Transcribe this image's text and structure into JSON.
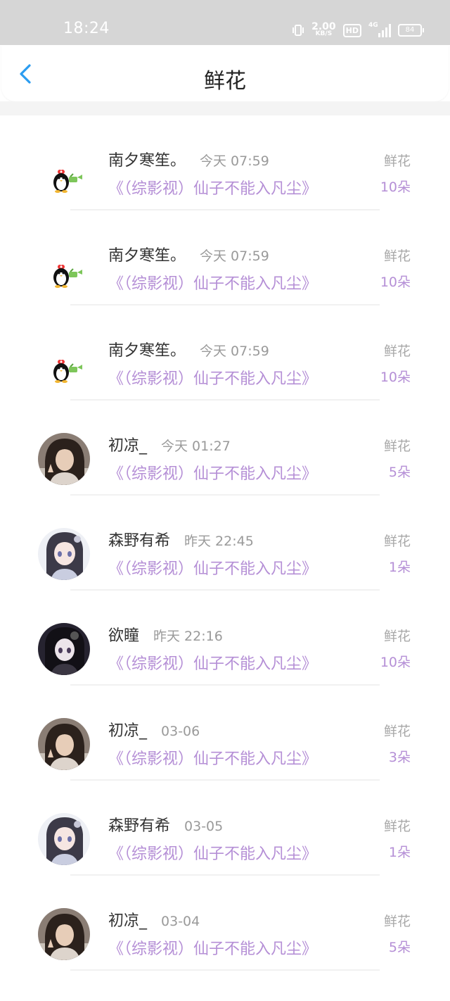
{
  "status": {
    "time": "18:24",
    "net_speed": "2.00",
    "net_unit": "KB/S",
    "hd": "HD",
    "signal": "4G",
    "battery": "84"
  },
  "header": {
    "title": "鲜花"
  },
  "records": [
    {
      "name": "南夕寒笙。",
      "time": "今天 07:59",
      "book": "《（综影视）仙子不能入凡尘》",
      "tag": "鲜花",
      "count": "10朵",
      "avatar": "penguin"
    },
    {
      "name": "南夕寒笙。",
      "time": "今天 07:59",
      "book": "《（综影视）仙子不能入凡尘》",
      "tag": "鲜花",
      "count": "10朵",
      "avatar": "penguin"
    },
    {
      "name": "南夕寒笙。",
      "time": "今天 07:59",
      "book": "《（综影视）仙子不能入凡尘》",
      "tag": "鲜花",
      "count": "10朵",
      "avatar": "penguin"
    },
    {
      "name": "初凉_",
      "time": "今天 01:27",
      "book": "《（综影视）仙子不能入凡尘》",
      "tag": "鲜花",
      "count": "5朵",
      "avatar": "photo-girl"
    },
    {
      "name": "森野有希",
      "time": "昨天 22:45",
      "book": "《（综影视）仙子不能入凡尘》",
      "tag": "鲜花",
      "count": "1朵",
      "avatar": "anime-light"
    },
    {
      "name": "欲瞳",
      "time": "昨天 22:16",
      "book": "《（综影视）仙子不能入凡尘》",
      "tag": "鲜花",
      "count": "10朵",
      "avatar": "anime-dark"
    },
    {
      "name": "初凉_",
      "time": "03-06",
      "book": "《（综影视）仙子不能入凡尘》",
      "tag": "鲜花",
      "count": "3朵",
      "avatar": "photo-girl"
    },
    {
      "name": "森野有希",
      "time": "03-05",
      "book": "《（综影视）仙子不能入凡尘》",
      "tag": "鲜花",
      "count": "1朵",
      "avatar": "anime-light"
    },
    {
      "name": "初凉_",
      "time": "03-04",
      "book": "《（综影视）仙子不能入凡尘》",
      "tag": "鲜花",
      "count": "5朵",
      "avatar": "photo-girl"
    }
  ],
  "colors": {
    "accent": "#b58fd6",
    "back": "#2a9cf0",
    "statusbar": "#d6d6d6"
  }
}
